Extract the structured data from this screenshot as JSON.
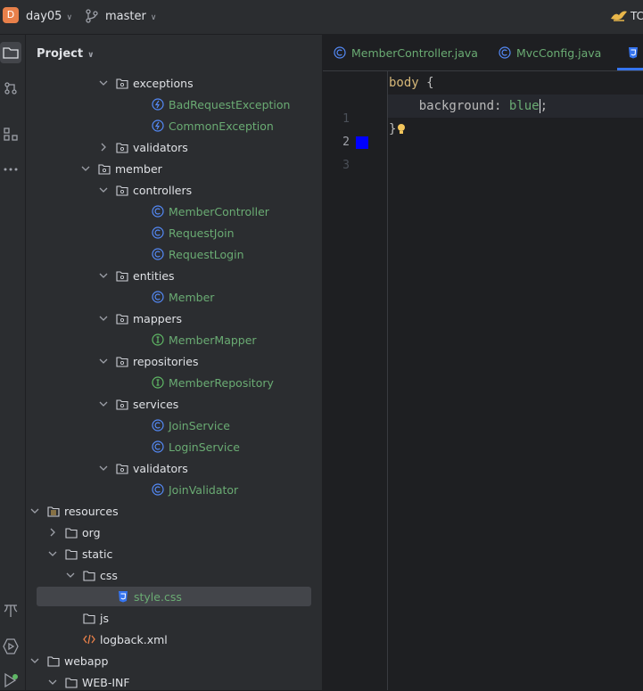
{
  "titlebar": {
    "project_badge": "D",
    "project_name": "day05",
    "branch_name": "master",
    "run_config": "TC"
  },
  "project_panel": {
    "title": "Project",
    "tree": [
      {
        "label": "exceptions",
        "kind": "folder",
        "state": "expanded"
      },
      {
        "label": "BadRequestException",
        "kind": "exception"
      },
      {
        "label": "CommonException",
        "kind": "exception"
      },
      {
        "label": "validators",
        "kind": "folder",
        "state": "collapsed"
      },
      {
        "label": "member",
        "kind": "folder",
        "state": "expanded"
      },
      {
        "label": "controllers",
        "kind": "folder",
        "state": "expanded"
      },
      {
        "label": "MemberController",
        "kind": "class"
      },
      {
        "label": "RequestJoin",
        "kind": "class"
      },
      {
        "label": "RequestLogin",
        "kind": "class"
      },
      {
        "label": "entities",
        "kind": "folder",
        "state": "expanded"
      },
      {
        "label": "Member",
        "kind": "class"
      },
      {
        "label": "mappers",
        "kind": "folder",
        "state": "expanded"
      },
      {
        "label": "MemberMapper",
        "kind": "interface"
      },
      {
        "label": "repositories",
        "kind": "folder",
        "state": "expanded"
      },
      {
        "label": "MemberRepository",
        "kind": "interface"
      },
      {
        "label": "services",
        "kind": "folder",
        "state": "expanded"
      },
      {
        "label": "JoinService",
        "kind": "class"
      },
      {
        "label": "LoginService",
        "kind": "class"
      },
      {
        "label": "validators",
        "kind": "folder",
        "state": "expanded"
      },
      {
        "label": "JoinValidator",
        "kind": "class"
      },
      {
        "label": "resources",
        "kind": "resources-folder",
        "state": "expanded"
      },
      {
        "label": "org",
        "kind": "plain-folder",
        "state": "collapsed"
      },
      {
        "label": "static",
        "kind": "plain-folder",
        "state": "expanded"
      },
      {
        "label": "css",
        "kind": "plain-folder",
        "state": "expanded"
      },
      {
        "label": "style.css",
        "kind": "css-file",
        "selected": true
      },
      {
        "label": "js",
        "kind": "plain-folder"
      },
      {
        "label": "logback.xml",
        "kind": "xml-file"
      },
      {
        "label": "webapp",
        "kind": "plain-folder",
        "state": "expanded"
      },
      {
        "label": "WEB-INF",
        "kind": "plain-folder",
        "state": "expanded"
      }
    ]
  },
  "editor": {
    "tabs": [
      {
        "label": "MemberController.java",
        "icon": "class-icon"
      },
      {
        "label": "MvcConfig.java",
        "icon": "class-icon"
      },
      {
        "label": "",
        "icon": "css-icon",
        "active": true
      }
    ],
    "line_numbers": [
      "1",
      "2",
      "3"
    ],
    "code": {
      "line1_selector": "body",
      "line1_brace": " {",
      "line2_property": "background",
      "line2_colon": ": ",
      "line2_value": "blue",
      "line2_semicolon": ";",
      "line3_brace": "}"
    },
    "swatch_color": "#0000ff"
  },
  "colors": {
    "accent": "#3574f0",
    "class_text": "#6aab73",
    "keyword": "#d5b778",
    "background": "#1e1f22",
    "panel": "#2b2d30"
  }
}
